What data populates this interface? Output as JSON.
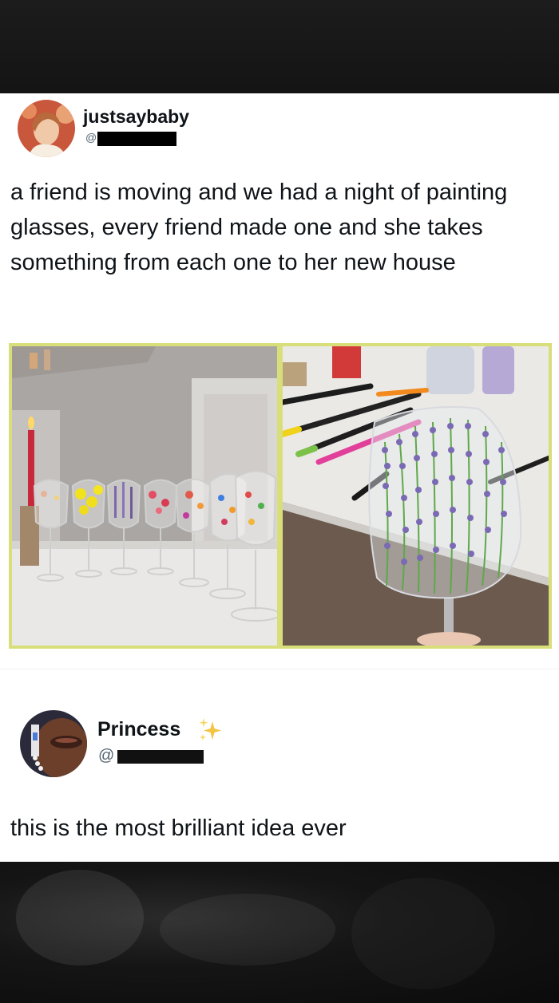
{
  "post1": {
    "user": {
      "display_name": "justsaybaby",
      "handle_prefix": "@"
    },
    "text": "a friend is moving and we had a night of painting glasses, every friend made one and she takes something from each one to her new house",
    "media": [
      "photo-painted-glasses-row",
      "photo-lavender-glass"
    ]
  },
  "post2": {
    "user": {
      "display_name": "Princess",
      "handle_prefix": "@",
      "badge_emoji": "✨"
    },
    "text": "this is the most brilliant idea ever"
  },
  "colors": {
    "text": "#0f1419",
    "handle": "#536471",
    "media_border": "#d8df7a"
  },
  "icons": [
    "sparkles-emoji"
  ]
}
